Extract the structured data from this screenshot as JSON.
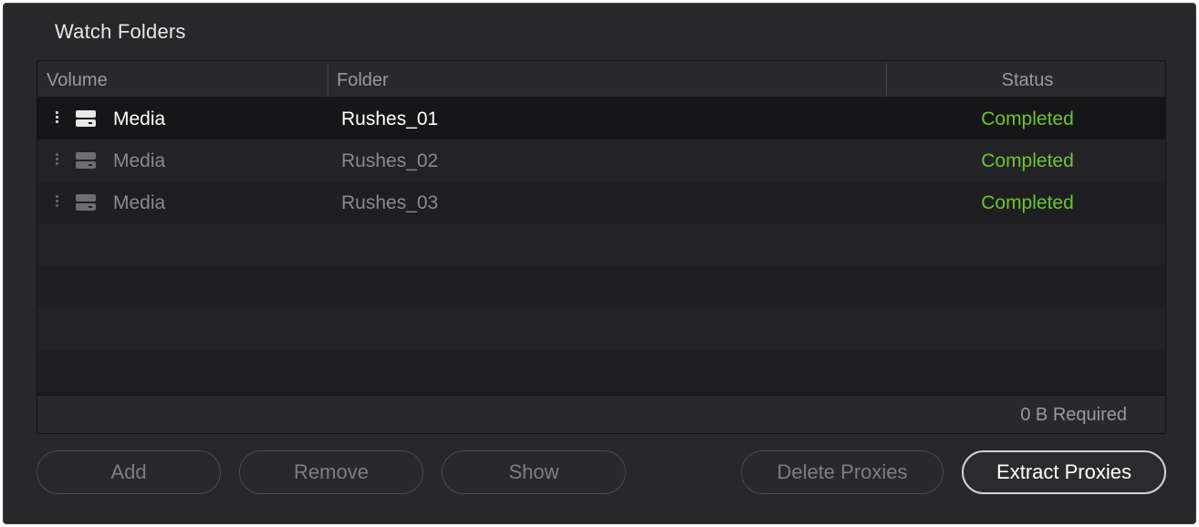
{
  "panel": {
    "title": "Watch Folders"
  },
  "table": {
    "columns": {
      "volume": "Volume",
      "folder": "Folder",
      "status": "Status"
    },
    "rows": [
      {
        "volume": "Media",
        "folder": "Rushes_01",
        "status": "Completed",
        "selected": true
      },
      {
        "volume": "Media",
        "folder": "Rushes_02",
        "status": "Completed",
        "selected": false
      },
      {
        "volume": "Media",
        "folder": "Rushes_03",
        "status": "Completed",
        "selected": false
      }
    ],
    "footer": {
      "required": "0 B Required"
    }
  },
  "buttons": {
    "add": "Add",
    "remove": "Remove",
    "show": "Show",
    "delete_proxies": "Delete Proxies",
    "extract_proxies": "Extract Proxies"
  },
  "icons": {
    "drag": "drag-handle-icon",
    "drive": "hard-drive-icon"
  },
  "colors": {
    "status_completed": "#6cc52e",
    "panel_bg": "#28282a"
  }
}
